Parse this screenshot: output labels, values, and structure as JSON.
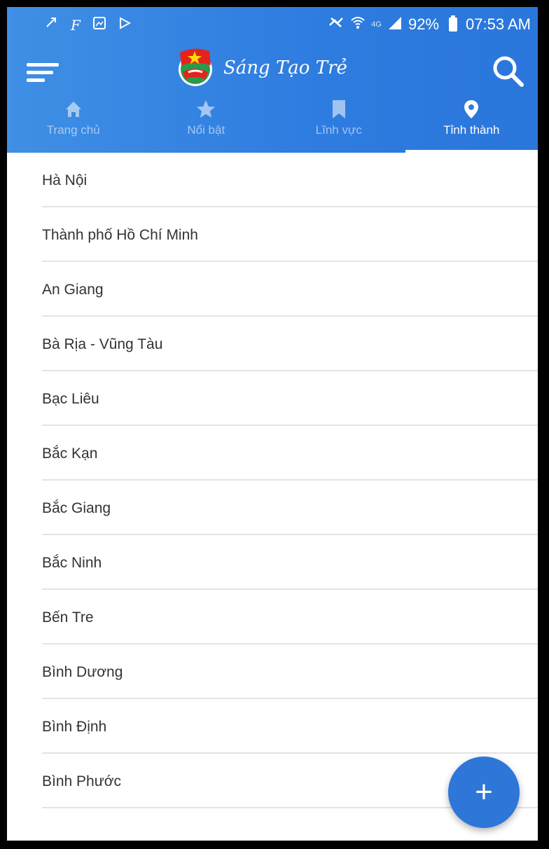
{
  "status_bar": {
    "battery": "92%",
    "time": "07:53 AM",
    "network": "4G"
  },
  "app": {
    "title": "Sáng Tạo Trẻ"
  },
  "tabs": [
    {
      "label": "Trang chủ",
      "icon": "home-icon"
    },
    {
      "label": "Nổi bật",
      "icon": "star-icon"
    },
    {
      "label": "Lĩnh vực",
      "icon": "bookmark-icon"
    },
    {
      "label": "Tỉnh thành",
      "icon": "location-pin-icon",
      "active": true
    }
  ],
  "provinces": [
    "Hà Nội",
    "Thành phố Hồ Chí Minh",
    "An Giang",
    "Bà Rịa - Vũng Tàu",
    "Bạc Liêu",
    "Bắc Kạn",
    "Bắc Giang",
    "Bắc Ninh",
    "Bến Tre",
    "Bình Dương",
    "Bình Định",
    "Bình Phước"
  ],
  "fab": {
    "label": "+"
  },
  "colors": {
    "primary": "#2f7de0",
    "fab": "#2e76d8",
    "text": "#333333",
    "divider": "#e3e3e3"
  }
}
